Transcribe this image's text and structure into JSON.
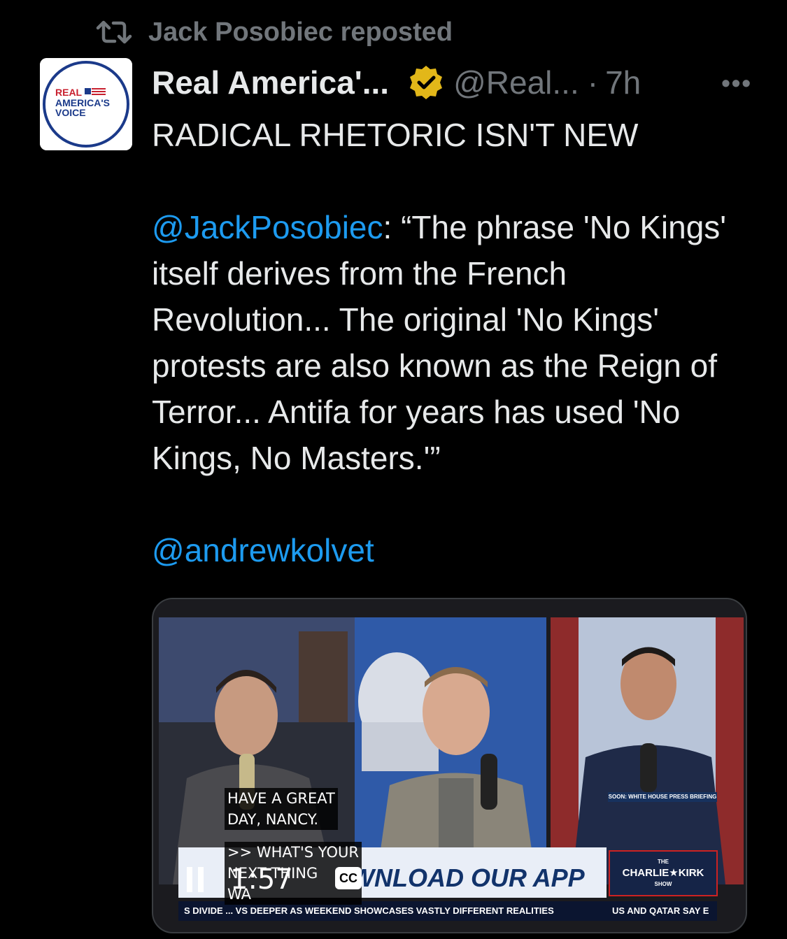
{
  "repost": {
    "label": "Jack Posobiec reposted",
    "icon": "repost-icon"
  },
  "post": {
    "avatar_text": [
      "REAL",
      "AMERICA'S",
      "VOICE"
    ],
    "display_name": "Real America'...",
    "handle": "@Real...",
    "separator": "·",
    "time": "7h",
    "more_label": "•••",
    "headline": "RADICAL RHETORIC ISN'T NEW",
    "quote_mention": "@JackPosobiec",
    "quote_text": ": “The phrase 'No Kings' itself derives from the French Revolution... The original 'No Kings' protests are also known as the Reign of Terror... Antifa for years has used 'No Kings, No Masters.'”",
    "tag_mention": "@andrewkolvet"
  },
  "video": {
    "caption_line1": "HAVE A GREAT\nDAY, NANCY.",
    "caption_line2": ">> WHAT'S YOUR\nNEXT THING\nWA",
    "timecode": "1:57",
    "cc_label": "CC",
    "banner_text": "WNLOAD OUR APP",
    "show_logo_top": "THE",
    "show_logo": "CHARLIE★KIRK",
    "show_logo_bottom": "SHOW",
    "briefing_label": "SOON: WHITE HOUSE PRESS BRIEFING",
    "crawl_left": "S DIVIDE ... VS DEEPER AS WEEKEND SHOWCASES VASTLY DIFFERENT REALITIES",
    "crawl_right": "US AND QATAR SAY E"
  },
  "colors": {
    "background": "#000000",
    "text": "#e7e9ea",
    "secondary": "#71767b",
    "link": "#1d9bf0",
    "verified_gold": "#e2b719"
  }
}
